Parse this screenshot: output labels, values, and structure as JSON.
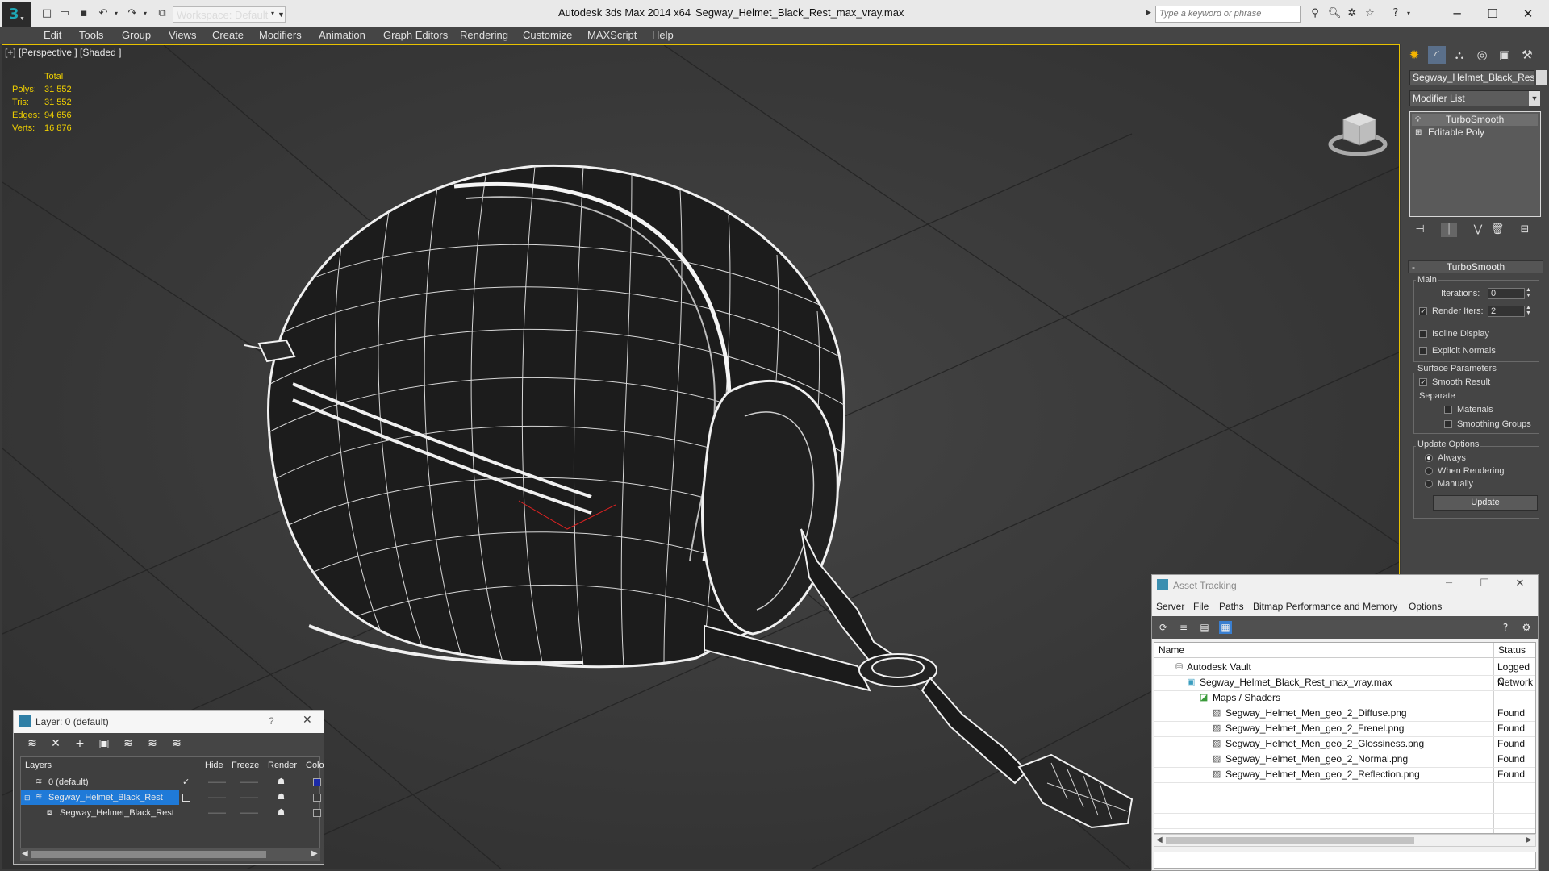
{
  "app": {
    "title": "Autodesk 3ds Max  2014 x64",
    "file": "Segway_Helmet_Black_Rest_max_vray.max",
    "workspace": "Workspace: Default",
    "search_placeholder": "Type a keyword or phrase"
  },
  "menu": [
    "Edit",
    "Tools",
    "Group",
    "Views",
    "Create",
    "Modifiers",
    "Animation",
    "Graph Editors",
    "Rendering",
    "Customize",
    "MAXScript",
    "Help"
  ],
  "viewport": {
    "label": "[+] [Perspective ] [Shaded ]",
    "stats": {
      "header": "Total",
      "rows": [
        {
          "label": "Polys:",
          "value": "31 552"
        },
        {
          "label": "Tris:",
          "value": "31 552"
        },
        {
          "label": "Edges:",
          "value": "94 656"
        },
        {
          "label": "Verts:",
          "value": "16 876"
        }
      ]
    }
  },
  "command_panel": {
    "object_name": "Segway_Helmet_Black_Rest",
    "modifier_list": "Modifier List",
    "stack": [
      "TurboSmooth",
      "Editable Poly"
    ],
    "turbosmooth": {
      "title": "TurboSmooth",
      "main": "Main",
      "iterations_label": "Iterations:",
      "iterations": "0",
      "render_iters_label": "Render Iters:",
      "render_iters": "2",
      "isoline": "Isoline Display",
      "explicit": "Explicit Normals",
      "surface_params": "Surface Parameters",
      "smooth_result": "Smooth Result",
      "separate": "Separate",
      "materials": "Materials",
      "smoothing_groups": "Smoothing Groups",
      "update_options": "Update Options",
      "always": "Always",
      "when_rendering": "When Rendering",
      "manually": "Manually",
      "update": "Update"
    }
  },
  "asset_tracking": {
    "title": "Asset Tracking",
    "menu": [
      "Server",
      "File",
      "Paths",
      "Bitmap Performance and Memory",
      "Options"
    ],
    "columns": {
      "name": "Name",
      "status": "Status"
    },
    "rows": [
      {
        "name": "Autodesk Vault",
        "status": "Logged C"
      },
      {
        "name": "Segway_Helmet_Black_Rest_max_vray.max",
        "status": "Network"
      },
      {
        "name": "Maps / Shaders",
        "status": ""
      },
      {
        "name": "Segway_Helmet_Men_geo_2_Diffuse.png",
        "status": "Found"
      },
      {
        "name": "Segway_Helmet_Men_geo_2_Frenel.png",
        "status": "Found"
      },
      {
        "name": "Segway_Helmet_Men_geo_2_Glossiness.png",
        "status": "Found"
      },
      {
        "name": "Segway_Helmet_Men_geo_2_Normal.png",
        "status": "Found"
      },
      {
        "name": "Segway_Helmet_Men_geo_2_Reflection.png",
        "status": "Found"
      }
    ]
  },
  "layers": {
    "title": "Layer: 0 (default)",
    "help": "?",
    "columns": [
      "Layers",
      "Hide",
      "Freeze",
      "Render",
      "Colo"
    ],
    "rows": [
      {
        "name": "0 (default)"
      },
      {
        "name": "Segway_Helmet_Black_Rest"
      },
      {
        "name": "Segway_Helmet_Black_Rest"
      }
    ]
  },
  "colors": {
    "accent": "#1ea7b5",
    "stats": "#f0d000",
    "selection": "#1f7ad8",
    "viewport_border": "#e8c200"
  }
}
